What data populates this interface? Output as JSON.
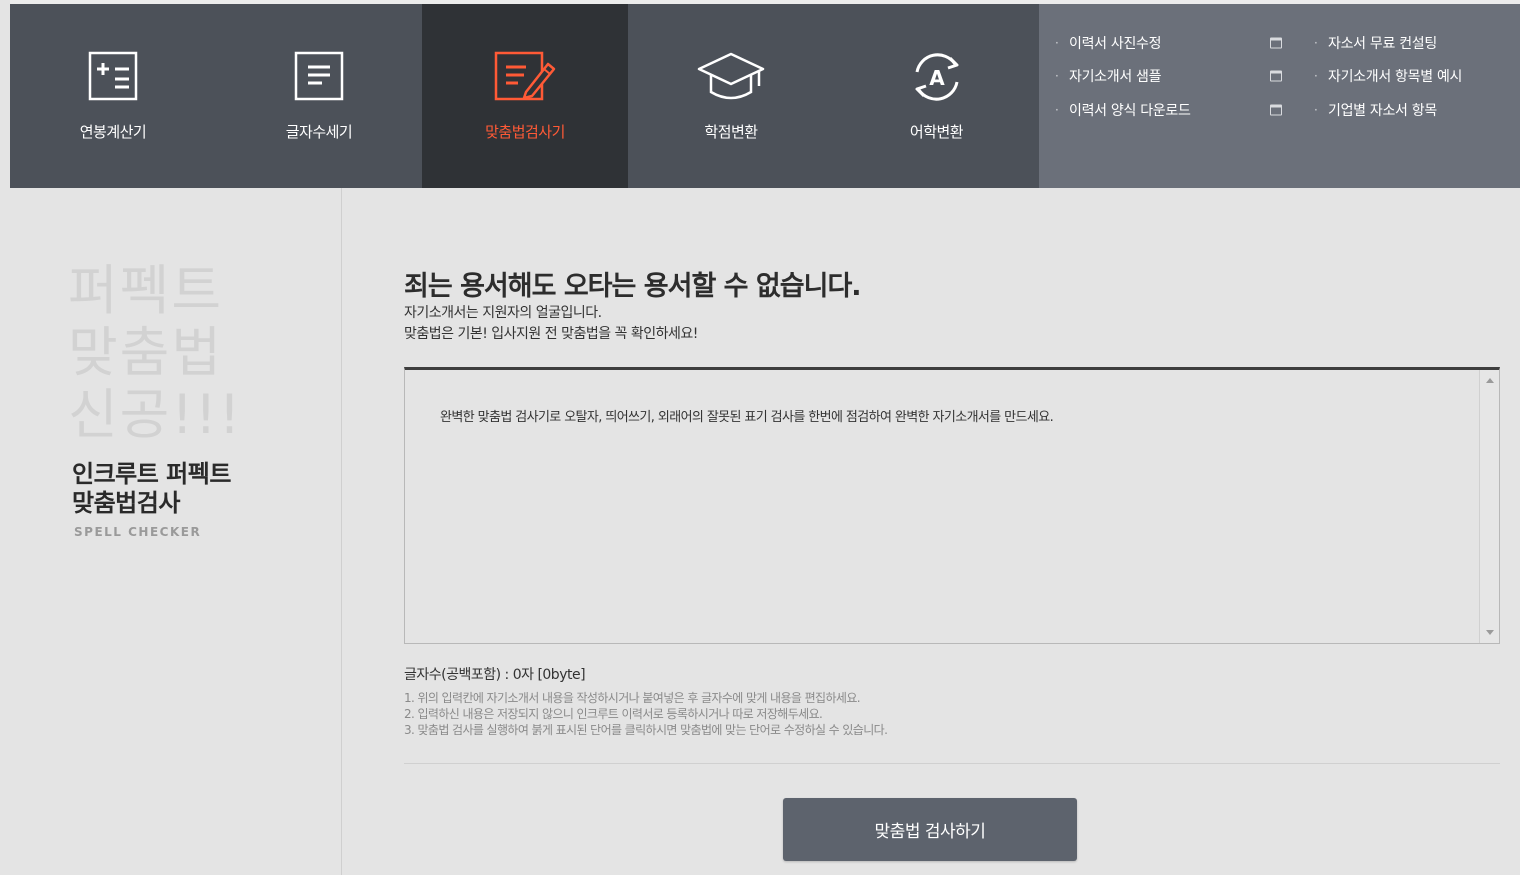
{
  "tools": [
    {
      "label": "연봉계산기",
      "icon": "calculator-icon",
      "active": false
    },
    {
      "label": "글자수세기",
      "icon": "document-icon",
      "active": false
    },
    {
      "label": "맞춤법검사기",
      "icon": "edit-document-icon",
      "active": true
    },
    {
      "label": "학점변환",
      "icon": "graduation-cap-icon",
      "active": false
    },
    {
      "label": "어학변환",
      "icon": "language-convert-icon",
      "active": false
    }
  ],
  "quick_links": {
    "col1": [
      "이력서 사진수정",
      "자기소개서 샘플",
      "이력서 양식 다운로드"
    ],
    "col2": [
      "자소서 무료 컨설팅",
      "자기소개서 항목별 예시",
      "기업별 자소서 항목"
    ]
  },
  "sidebar": {
    "big_title": [
      "퍼펙트",
      "맞춤법",
      "신공!!!"
    ],
    "subtitle": [
      "인크루트 퍼펙트",
      "맞춤법검사"
    ],
    "eng_title": "SPELL CHECKER"
  },
  "main": {
    "headline": "죄는 용서해도 오타는 용서할 수 없습니다.",
    "desc1": "자기소개서는 지원자의 얼굴입니다.",
    "desc2": "맞춤법은 기본! 입사지원 전 맞춤법을 꼭 확인하세요!",
    "textarea_text": "완벽한 맞춤법 검사기로 오탈자, 띄어쓰기, 외래어의 잘못된 표기 검사를 한번에 점검하여 완벽한 자기소개서를 만드세요.",
    "counter": "글자수(공백포함) : 0자 [0byte]",
    "notes": [
      "1. 위의 입력칸에 자기소개서 내용을 작성하시거나 붙여넣은 후 글자수에 맞게 내용을 편집하세요.",
      "2. 입력하신 내용은 저장되지 않으니 인크루트 이력서로 등록하시거나 따로 저장해두세요.",
      "3. 맞춤법 검사를 실행하여 붉게 표시된 단어를 클릭하시면 맞춤법에 맞는 단어로 수정하실 수 있습니다."
    ],
    "button_label": "맞춤법 검사하기"
  },
  "colors": {
    "nav_bg": "#4c5159",
    "nav_active_bg": "#2f3236",
    "accent": "#ff5a36",
    "quick_bg": "#6b707a",
    "button_bg": "#5d636d"
  }
}
